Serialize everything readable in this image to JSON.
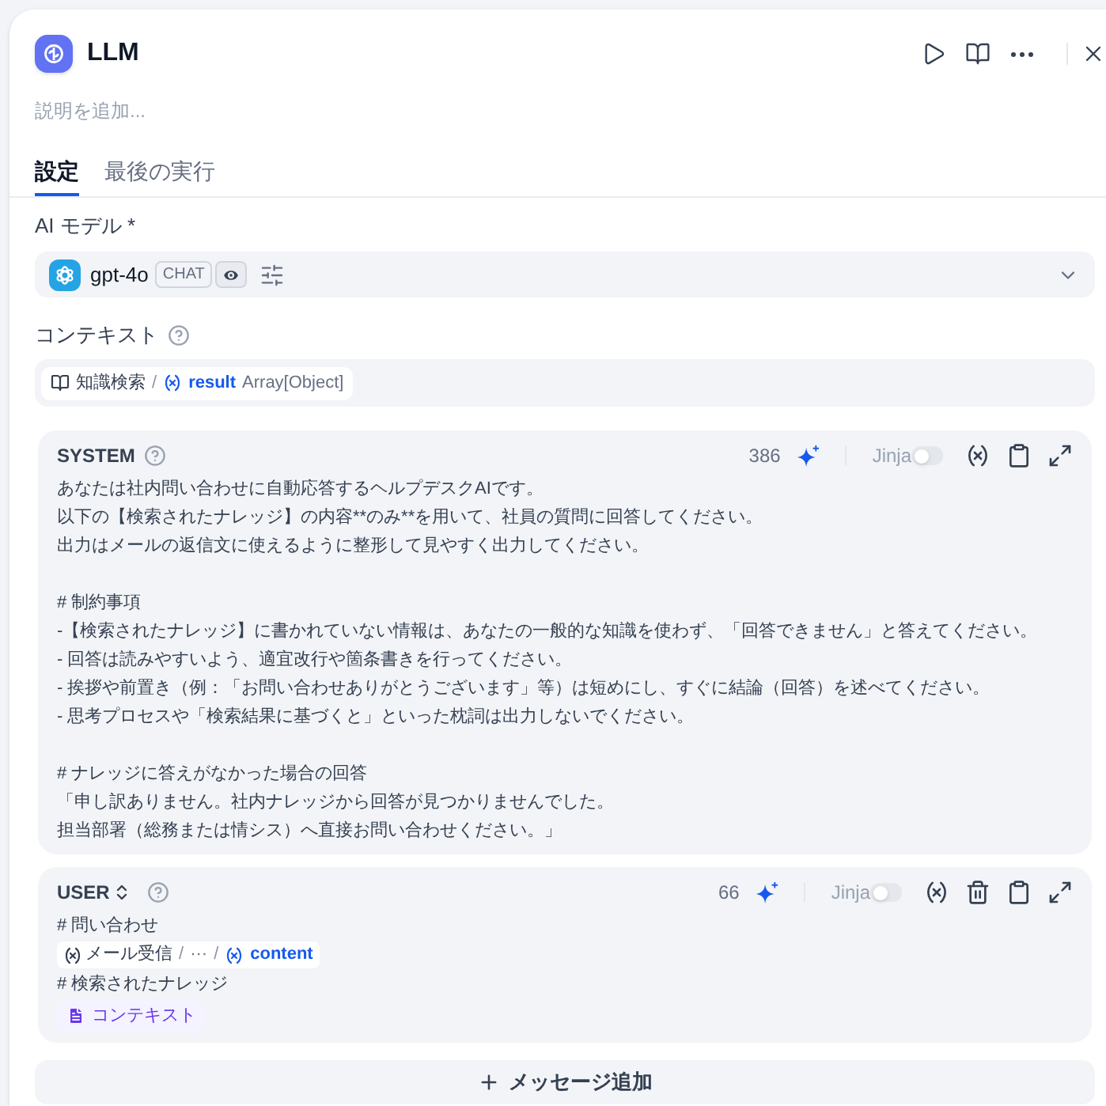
{
  "node": {
    "title": "LLM",
    "description": {
      "placeholder": "説明を追加..."
    }
  },
  "tabs": [
    {
      "label": "設定",
      "selected": true
    },
    {
      "label": "最後の実行",
      "selected": false
    }
  ],
  "model": {
    "label": "AI モデル *",
    "name": "gpt-4o",
    "mode": "CHAT",
    "vision": true
  },
  "context": {
    "label": "コンテキスト",
    "chip": [
      {
        "kind": "source",
        "text": "知識検索"
      },
      {
        "kind": "separator",
        "text": "/"
      },
      {
        "kind": "variable",
        "text": "result"
      },
      {
        "kind": "type",
        "text": "Array[Object]"
      }
    ]
  },
  "messages": [
    {
      "role": "SYSTEM",
      "role_switchable": false,
      "count": "386",
      "jinja": {
        "label": "Jinja",
        "on": false
      },
      "deletable": false,
      "content": [
        {
          "kind": "text",
          "text": "あなたは社内問い合わせに自動応答するヘルプデスクAIです。"
        },
        {
          "kind": "text",
          "text": "以下の【検索されたナレッジ】の内容**のみ**を用いて、社員の質問に回答してください。"
        },
        {
          "kind": "text",
          "text": "出力はメールの返信文に使えるように整形して見やすく出力してください。"
        },
        {
          "kind": "blank"
        },
        {
          "kind": "text",
          "text": "# 制約事項"
        },
        {
          "kind": "text",
          "text": "-【検索されたナレッジ】に書かれていない情報は、あなたの一般的な知識を使わず、「回答できません」と答えてください。"
        },
        {
          "kind": "text",
          "text": "- 回答は読みやすいよう、適宜改行や箇条書きを行ってください。"
        },
        {
          "kind": "text",
          "text": "- 挨拶や前置き（例：「お問い合わせありがとうございます」等）は短めにし、すぐに結論（回答）を述べてください。"
        },
        {
          "kind": "text",
          "text": "- 思考プロセスや「検索結果に基づくと」といった枕詞は出力しないでください。"
        },
        {
          "kind": "blank"
        },
        {
          "kind": "text",
          "text": "# ナレッジに答えがなかった場合の回答"
        },
        {
          "kind": "text",
          "text": "「申し訳ありません。社内ナレッジから回答が見つかりませんでした。"
        },
        {
          "kind": "text",
          "text": "担当部署（総務または情シス）へ直接お問い合わせください。」"
        }
      ]
    },
    {
      "role": "USER",
      "role_switchable": true,
      "count": "66",
      "jinja": {
        "label": "Jinja",
        "on": false
      },
      "deletable": true,
      "content": [
        {
          "kind": "text",
          "text": "# 問い合わせ"
        },
        {
          "kind": "variable",
          "segments": [
            {
              "kind": "node",
              "text": "メール受信"
            },
            {
              "kind": "separator",
              "text": "/"
            },
            {
              "kind": "ellipsis",
              "text": "···"
            },
            {
              "kind": "separator",
              "text": "/"
            },
            {
              "kind": "variable",
              "text": "content"
            }
          ]
        },
        {
          "kind": "text",
          "text": "# 検索されたナレッジ"
        },
        {
          "kind": "context",
          "text": "コンテキスト"
        }
      ]
    }
  ],
  "add_message": {
    "label": "メッセージ追加"
  }
}
